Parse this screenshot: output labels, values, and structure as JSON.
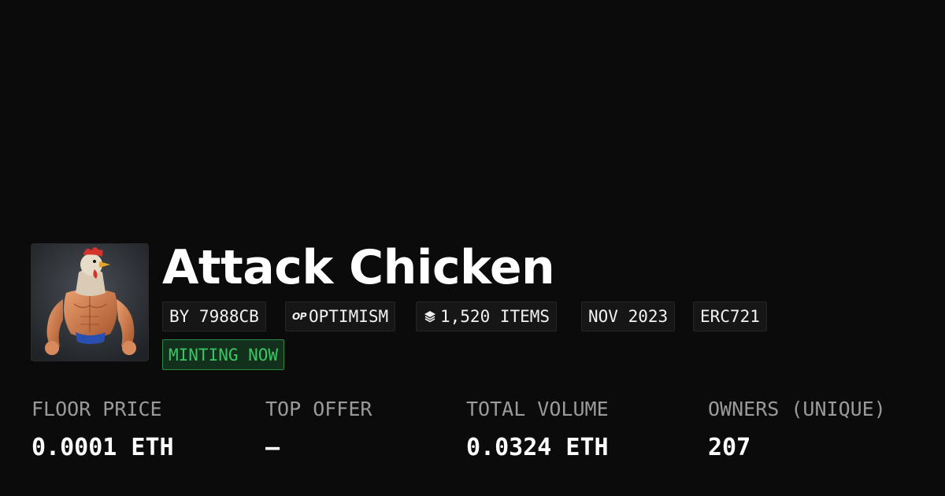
{
  "collection": {
    "name": "Attack Chicken",
    "avatar_icon": "muscular-chicken-avatar",
    "badges": {
      "creator": "BY 7988CB",
      "chain_logo": "OP",
      "chain": "OPTIMISM",
      "items": "1,520 ITEMS",
      "created": "NOV 2023",
      "standard": "ERC721"
    },
    "status": "MINTING NOW"
  },
  "stats": {
    "floor_price": {
      "label": "FLOOR PRICE",
      "value": "0.0001 ETH"
    },
    "top_offer": {
      "label": "TOP OFFER",
      "value": "—"
    },
    "total_volume": {
      "label": "TOTAL VOLUME",
      "value": "0.0324 ETH"
    },
    "owners": {
      "label": "OWNERS (UNIQUE)",
      "value": "207"
    }
  },
  "colors": {
    "background": "#0b0b0b",
    "badge_bg": "#161616",
    "minting_text": "#39c763",
    "minting_border": "#2c8a48",
    "label_gray": "#9a9a9a"
  }
}
